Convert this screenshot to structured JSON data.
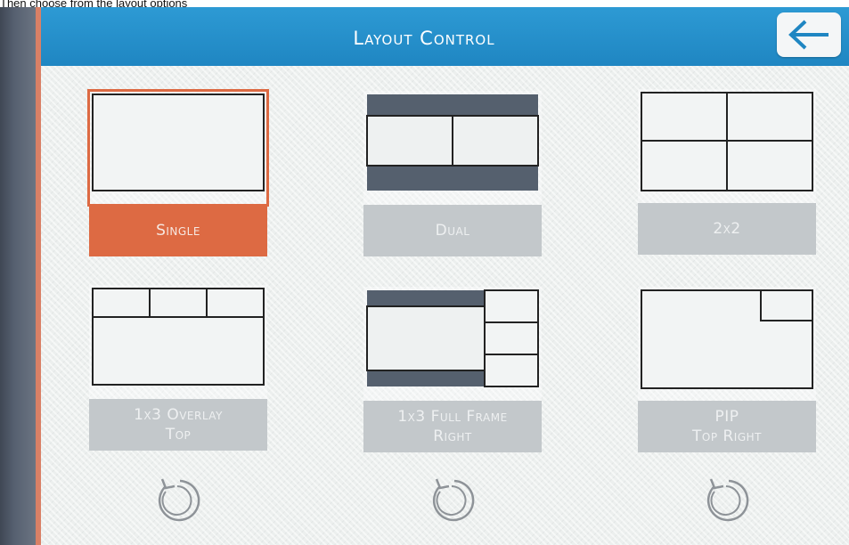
{
  "caption": "Then choose from the layout options",
  "header": {
    "title": "Layout Control",
    "back_icon": "arrow-left-icon"
  },
  "layouts": [
    {
      "label_line1": "Single",
      "label_line2": "",
      "selected": true
    },
    {
      "label_line1": "Dual",
      "label_line2": "",
      "selected": false
    },
    {
      "label_line1": "2x2",
      "label_line2": "",
      "selected": false
    },
    {
      "label_line1": "1x3 Overlay",
      "label_line2": "Top",
      "selected": false
    },
    {
      "label_line1": "1x3 Full Frame",
      "label_line2": "Right",
      "selected": false
    },
    {
      "label_line1": "PIP",
      "label_line2": "Top Right",
      "selected": false
    }
  ],
  "refresh_icons": [
    "rotate-ccw-icon",
    "rotate-ccw-icon",
    "rotate-ccw-icon"
  ],
  "colors": {
    "header": "#1f86c2",
    "selected": "#dd6a43",
    "tile_label": "#c3c8cb",
    "preview_bar": "#55606e"
  }
}
